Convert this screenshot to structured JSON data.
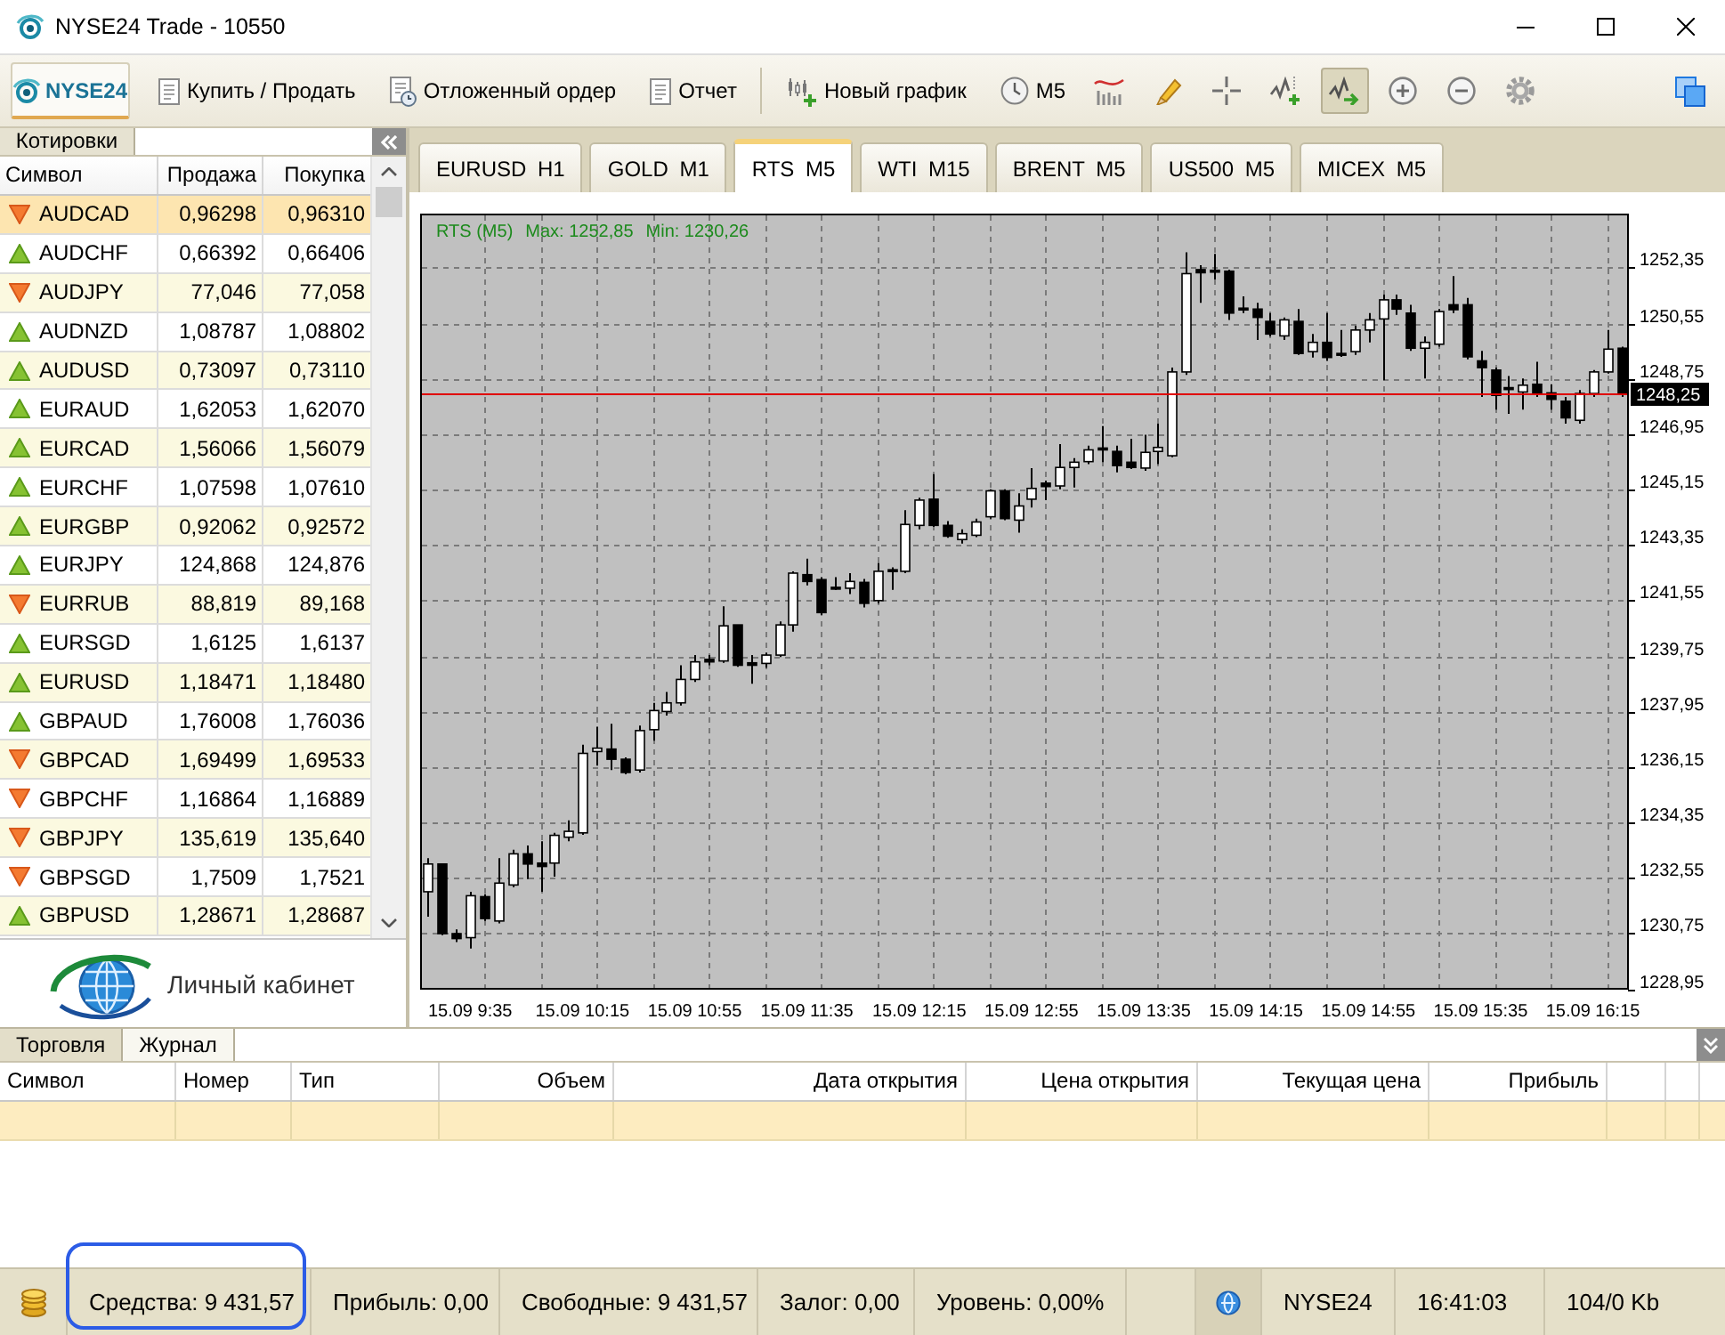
{
  "window": {
    "title": "NYSE24 Trade - 10550"
  },
  "toolbar": {
    "logo": "NYSE24",
    "items": [
      {
        "kind": "buy",
        "label": "Купить / Продать",
        "active": false
      },
      {
        "kind": "pending",
        "label": "Отложенный ордер",
        "active": false
      },
      {
        "kind": "report",
        "label": "Отчет",
        "active": false
      },
      {
        "kind": "chart",
        "label": "Новый график",
        "active": false
      },
      {
        "kind": "period",
        "label": "M5",
        "active": false
      },
      {
        "kind": "indicators",
        "active": false
      },
      {
        "kind": "pencil",
        "active": false
      },
      {
        "kind": "crosshair",
        "active": false
      },
      {
        "kind": "addline",
        "active": false
      },
      {
        "kind": "autoscroll",
        "active": true
      },
      {
        "kind": "zoomin",
        "active": false
      },
      {
        "kind": "zoomout",
        "active": false
      },
      {
        "kind": "settings",
        "active": false
      }
    ]
  },
  "quotes": {
    "tab": "Котировки",
    "columns": [
      "Символ",
      "Продажа",
      "Покупка"
    ],
    "rows": [
      {
        "symbol": "AUDCAD",
        "bid": "0,96298",
        "ask": "0,96310",
        "rising": false,
        "selected": true
      },
      {
        "symbol": "AUDCHF",
        "bid": "0,66392",
        "ask": "0,66406",
        "rising": true,
        "selected": false
      },
      {
        "symbol": "AUDJPY",
        "bid": "77,046",
        "ask": "77,058",
        "rising": false,
        "selected": false
      },
      {
        "symbol": "AUDNZD",
        "bid": "1,08787",
        "ask": "1,08802",
        "rising": true,
        "selected": false
      },
      {
        "symbol": "AUDUSD",
        "bid": "0,73097",
        "ask": "0,73110",
        "rising": true,
        "selected": false
      },
      {
        "symbol": "EURAUD",
        "bid": "1,62053",
        "ask": "1,62070",
        "rising": true,
        "selected": false
      },
      {
        "symbol": "EURCAD",
        "bid": "1,56066",
        "ask": "1,56079",
        "rising": true,
        "selected": false
      },
      {
        "symbol": "EURCHF",
        "bid": "1,07598",
        "ask": "1,07610",
        "rising": true,
        "selected": false
      },
      {
        "symbol": "EURGBP",
        "bid": "0,92062",
        "ask": "0,92572",
        "rising": true,
        "selected": false
      },
      {
        "symbol": "EURJPY",
        "bid": "124,868",
        "ask": "124,876",
        "rising": true,
        "selected": false
      },
      {
        "symbol": "EURRUB",
        "bid": "88,819",
        "ask": "89,168",
        "rising": false,
        "selected": false
      },
      {
        "symbol": "EURSGD",
        "bid": "1,6125",
        "ask": "1,6137",
        "rising": true,
        "selected": false
      },
      {
        "symbol": "EURUSD",
        "bid": "1,18471",
        "ask": "1,18480",
        "rising": true,
        "selected": false
      },
      {
        "symbol": "GBPAUD",
        "bid": "1,76008",
        "ask": "1,76036",
        "rising": true,
        "selected": false
      },
      {
        "symbol": "GBPCAD",
        "bid": "1,69499",
        "ask": "1,69533",
        "rising": false,
        "selected": false
      },
      {
        "symbol": "GBPCHF",
        "bid": "1,16864",
        "ask": "1,16889",
        "rising": false,
        "selected": false
      },
      {
        "symbol": "GBPJPY",
        "bid": "135,619",
        "ask": "135,640",
        "rising": false,
        "selected": false
      },
      {
        "symbol": "GBPSGD",
        "bid": "1,7509",
        "ask": "1,7521",
        "rising": false,
        "selected": false
      },
      {
        "symbol": "GBPUSD",
        "bid": "1,28671",
        "ask": "1,28687",
        "rising": true,
        "selected": false
      }
    ]
  },
  "cabinet_button": "Личный кабинет",
  "chart_tabs": [
    {
      "label": "EURUSD H1",
      "selected": false
    },
    {
      "label": "GOLD M1",
      "selected": false
    },
    {
      "label": "RTS M5",
      "selected": true
    },
    {
      "label": "WTI M15",
      "selected": false
    },
    {
      "label": "BRENT M5",
      "selected": false
    },
    {
      "label": "US500 M5",
      "selected": false
    },
    {
      "label": "MICEX M5",
      "selected": false
    }
  ],
  "chart": {
    "legend": [
      "RTS (M5)",
      "Max: 1252,85",
      "Min: 1230,26"
    ],
    "chart_data": {
      "type": "candlestick",
      "grid": true,
      "categories": [
        null,
        null,
        null,
        "15.09 9:35",
        null,
        null,
        null,
        null,
        null,
        null,
        null,
        "15.09 10:15",
        null,
        null,
        null,
        null,
        null,
        null,
        null,
        "15.09 10:55",
        null,
        null,
        null,
        null,
        null,
        null,
        null,
        "15.09 11:35",
        null,
        null,
        null,
        null,
        null,
        null,
        null,
        "15.09 12:15",
        null,
        null,
        null,
        null,
        null,
        null,
        null,
        "15.09 12:55",
        null,
        null,
        null,
        null,
        null,
        null,
        null,
        "15.09 13:35",
        null,
        null,
        null,
        null,
        null,
        null,
        null,
        "15.09 14:15",
        null,
        null,
        null,
        null,
        null,
        null,
        null,
        "15.09 14:55",
        null,
        null,
        null,
        null,
        null,
        null,
        null,
        "15.09 15:35",
        null,
        null,
        null,
        null,
        null,
        null,
        null,
        "15.09 16:15",
        null,
        null
      ],
      "ohlc": [
        [
          1232.1,
          1233.19,
          1231.29,
          1233.0
        ],
        [
          1233.0,
          1233.0,
          1230.69,
          1230.74
        ],
        [
          1230.74,
          1230.88,
          1230.47,
          1230.58
        ],
        [
          1230.61,
          1232.1,
          1230.26,
          1231.97
        ],
        [
          1231.94,
          1232.02,
          1231.15,
          1231.23
        ],
        [
          1231.15,
          1233.19,
          1231.07,
          1232.38
        ],
        [
          1232.32,
          1233.46,
          1232.24,
          1233.33
        ],
        [
          1233.33,
          1233.6,
          1232.51,
          1233.0
        ],
        [
          1233.03,
          1233.74,
          1232.1,
          1232.92
        ],
        [
          1233.03,
          1234.01,
          1232.59,
          1233.93
        ],
        [
          1233.87,
          1234.42,
          1233.74,
          1234.06
        ],
        [
          1234.01,
          1236.87,
          1233.95,
          1236.59
        ],
        [
          1236.65,
          1237.46,
          1236.19,
          1236.76
        ],
        [
          1236.73,
          1237.55,
          1236.05,
          1236.4
        ],
        [
          1236.4,
          1236.46,
          1235.91,
          1235.97
        ],
        [
          1236.05,
          1237.49,
          1235.97,
          1237.33
        ],
        [
          1237.36,
          1238.23,
          1237.0,
          1237.98
        ],
        [
          1237.95,
          1238.58,
          1237.82,
          1238.23
        ],
        [
          1238.23,
          1239.45,
          1238.14,
          1238.99
        ],
        [
          1238.99,
          1239.78,
          1238.91,
          1239.56
        ],
        [
          1239.64,
          1239.78,
          1239.45,
          1239.56
        ],
        [
          1239.59,
          1241.36,
          1239.53,
          1240.73
        ],
        [
          1240.76,
          1240.76,
          1239.4,
          1239.45
        ],
        [
          1239.53,
          1239.78,
          1238.85,
          1239.45
        ],
        [
          1239.51,
          1239.86,
          1239.37,
          1239.78
        ],
        [
          1239.78,
          1240.87,
          1239.72,
          1240.76
        ],
        [
          1240.76,
          1242.5,
          1240.54,
          1242.44
        ],
        [
          1242.39,
          1242.91,
          1242.04,
          1242.17
        ],
        [
          1242.23,
          1242.31,
          1241.08,
          1241.16
        ],
        [
          1241.98,
          1242.31,
          1241.9,
          1241.93
        ],
        [
          1241.95,
          1242.44,
          1241.76,
          1242.17
        ],
        [
          1242.14,
          1242.25,
          1241.33,
          1241.46
        ],
        [
          1241.55,
          1242.77,
          1241.46,
          1242.5
        ],
        [
          1242.55,
          1242.63,
          1241.9,
          1242.5
        ],
        [
          1242.5,
          1244.48,
          1242.44,
          1244.02
        ],
        [
          1243.99,
          1244.89,
          1243.86,
          1244.81
        ],
        [
          1244.84,
          1245.65,
          1243.94,
          1243.99
        ],
        [
          1243.99,
          1244.13,
          1243.59,
          1243.64
        ],
        [
          1243.53,
          1243.86,
          1243.4,
          1243.72
        ],
        [
          1243.67,
          1244.21,
          1243.61,
          1244.1
        ],
        [
          1244.27,
          1245.16,
          1244.21,
          1245.11
        ],
        [
          1245.11,
          1245.16,
          1244.16,
          1244.21
        ],
        [
          1244.16,
          1245.03,
          1243.75,
          1244.62
        ],
        [
          1244.84,
          1245.85,
          1244.57,
          1245.19
        ],
        [
          1245.36,
          1245.44,
          1244.81,
          1245.25
        ],
        [
          1245.27,
          1246.63,
          1245.16,
          1245.87
        ],
        [
          1245.87,
          1246.17,
          1245.22,
          1246.04
        ],
        [
          1246.06,
          1246.58,
          1245.98,
          1246.44
        ],
        [
          1246.5,
          1247.21,
          1246.04,
          1246.44
        ],
        [
          1246.39,
          1246.58,
          1245.71,
          1245.93
        ],
        [
          1246.04,
          1246.8,
          1245.82,
          1245.87
        ],
        [
          1245.85,
          1246.93,
          1245.76,
          1246.36
        ],
        [
          1246.39,
          1247.29,
          1245.98,
          1246.52
        ],
        [
          1246.25,
          1249.11,
          1246.2,
          1248.97
        ],
        [
          1248.97,
          1252.85,
          1248.87,
          1252.16
        ],
        [
          1252.29,
          1252.43,
          1251.21,
          1252.19
        ],
        [
          1252.27,
          1252.8,
          1251.97,
          1252.21
        ],
        [
          1252.24,
          1252.29,
          1250.66,
          1250.88
        ],
        [
          1251.04,
          1251.42,
          1250.88,
          1250.99
        ],
        [
          1251.01,
          1251.21,
          1250.01,
          1250.74
        ],
        [
          1250.61,
          1250.88,
          1250.12,
          1250.2
        ],
        [
          1250.14,
          1250.74,
          1250.01,
          1250.66
        ],
        [
          1250.61,
          1251.01,
          1249.52,
          1249.57
        ],
        [
          1249.63,
          1250.2,
          1249.44,
          1249.93
        ],
        [
          1249.93,
          1250.88,
          1249.33,
          1249.44
        ],
        [
          1249.57,
          1250.33,
          1249.46,
          1249.52
        ],
        [
          1249.63,
          1250.47,
          1249.52,
          1250.33
        ],
        [
          1250.33,
          1250.88,
          1249.93,
          1250.66
        ],
        [
          1250.69,
          1251.48,
          1248.7,
          1251.31
        ],
        [
          1251.31,
          1251.48,
          1250.82,
          1251.01
        ],
        [
          1250.88,
          1251.15,
          1249.65,
          1249.74
        ],
        [
          1249.74,
          1250.12,
          1248.76,
          1249.93
        ],
        [
          1249.87,
          1251.01,
          1249.79,
          1250.93
        ],
        [
          1251.15,
          1252.08,
          1250.88,
          1250.99
        ],
        [
          1251.15,
          1251.37,
          1249.38,
          1249.46
        ],
        [
          1249.33,
          1249.65,
          1248.16,
          1249.11
        ],
        [
          1249.03,
          1249.11,
          1247.75,
          1248.21
        ],
        [
          1248.46,
          1248.84,
          1247.61,
          1248.4
        ],
        [
          1248.32,
          1248.76,
          1247.75,
          1248.54
        ],
        [
          1248.57,
          1249.3,
          1248.16,
          1248.29
        ],
        [
          1248.29,
          1248.57,
          1247.75,
          1248.08
        ],
        [
          1248.02,
          1248.16,
          1247.29,
          1247.48
        ],
        [
          1247.4,
          1248.38,
          1247.29,
          1248.27
        ],
        [
          1248.27,
          1249.03,
          1248.16,
          1248.97
        ],
        [
          1248.97,
          1250.33,
          1248.92,
          1249.71
        ],
        [
          1249.74,
          1249.79,
          1248.16,
          1248.25
        ]
      ],
      "ylim": [
        1228.95,
        1254.08
      ],
      "yticks": [
        {
          "value": 1252.35,
          "label": "1252,35"
        },
        {
          "value": 1250.55,
          "label": "1250,55"
        },
        {
          "value": 1248.75,
          "label": "1248,75"
        },
        {
          "value": 1246.95,
          "label": "1246,95"
        },
        {
          "value": 1245.15,
          "label": "1245,15"
        },
        {
          "value": 1243.35,
          "label": "1243,35"
        },
        {
          "value": 1241.55,
          "label": "1241,55"
        },
        {
          "value": 1239.75,
          "label": "1239,75"
        },
        {
          "value": 1237.95,
          "label": "1237,95"
        },
        {
          "value": 1236.15,
          "label": "1236,15"
        },
        {
          "value": 1234.35,
          "label": "1234,35"
        },
        {
          "value": 1232.55,
          "label": "1232,55"
        },
        {
          "value": 1230.75,
          "label": "1230,75"
        },
        {
          "value": 1228.95,
          "label": "1228,95"
        }
      ],
      "ref_lines": [
        {
          "axis": "y",
          "value": 1248.25,
          "label": "1248,25",
          "color": "#e00000"
        }
      ]
    }
  },
  "terminal": {
    "tabs": [
      {
        "label": "Торговля",
        "selected": true
      },
      {
        "label": "Журнал",
        "selected": false
      }
    ],
    "columns": [
      "Символ",
      "Номер",
      "Тип",
      "Объем",
      "Дата открытия",
      "Цена открытия",
      "Текущая цена",
      "Прибыль"
    ]
  },
  "status_bar": {
    "account": [
      {
        "text": "Средства: 9 431,57",
        "highlighted": true
      },
      {
        "text": "Прибыль: 0,00",
        "highlighted": false
      },
      {
        "text": "Свободные: 9 431,57",
        "highlighted": false
      },
      {
        "text": "Залог: 0,00",
        "highlighted": false
      },
      {
        "text": "Уровень: 0,00%",
        "highlighted": false
      }
    ],
    "server": "NYSE24",
    "time": "16:41:03",
    "traffic": "104/0 Kb"
  }
}
